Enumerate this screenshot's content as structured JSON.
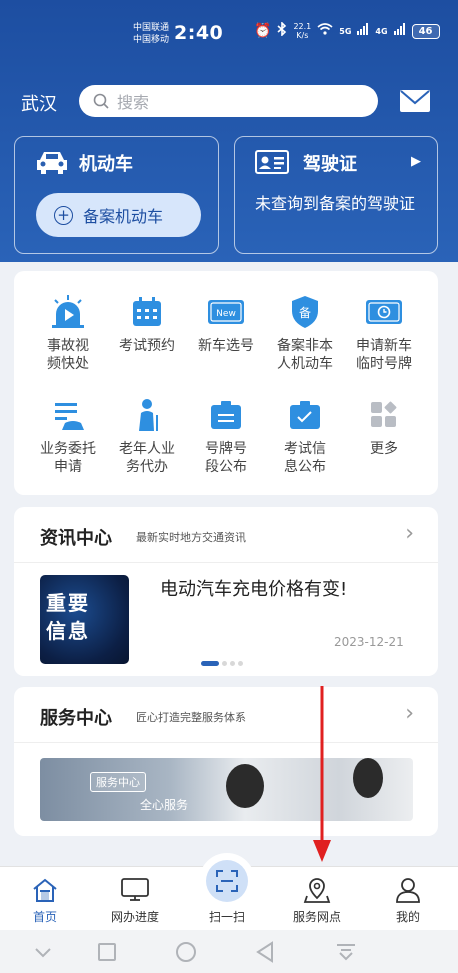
{
  "status_bar": {
    "carrier_1": "中国联通",
    "carrier_2": "中国移动",
    "time": "2:40",
    "net_speed_value": "22.1",
    "net_speed_unit": "K/s",
    "signal_1": "5G",
    "signal_2": "4G",
    "battery": "46"
  },
  "header": {
    "city": "武汉",
    "search_placeholder": "搜索"
  },
  "vehicle_card": {
    "title": "机动车",
    "button_label": "备案机动车"
  },
  "license_card": {
    "title": "驾驶证",
    "message": "未查询到备案的驾驶证"
  },
  "services": [
    {
      "label": "事故视频快处",
      "icon": "accident-video-icon"
    },
    {
      "label": "考试预约",
      "icon": "calendar-icon"
    },
    {
      "label": "新车选号",
      "icon": "new-plate-icon"
    },
    {
      "label": "备案非本人机动车",
      "icon": "shield-icon"
    },
    {
      "label": "申请新车临时号牌",
      "icon": "temp-plate-icon"
    },
    {
      "label": "业务委托申请",
      "icon": "delegate-icon"
    },
    {
      "label": "老年人业务代办",
      "icon": "elderly-icon"
    },
    {
      "label": "号牌号段公布",
      "icon": "plate-segment-icon"
    },
    {
      "label": "考试信息公布",
      "icon": "exam-info-icon"
    },
    {
      "label": "更多",
      "icon": "more-icon"
    }
  ],
  "news": {
    "title": "资讯中心",
    "subtitle": "最新实时地方交通资讯",
    "thumb_text": "重要信息",
    "item_title": "电动汽车充电价格有变!",
    "item_date": "2023-12-21"
  },
  "service_center": {
    "title": "服务中心",
    "subtitle": "匠心打造完整服务体系",
    "banner_tag": "服务中心",
    "banner_text": "全心服务"
  },
  "tabbar": [
    {
      "label": "首页",
      "icon": "home-icon",
      "active": true
    },
    {
      "label": "网办进度",
      "icon": "monitor-icon",
      "active": false
    },
    {
      "label": "扫一扫",
      "icon": "scan-icon",
      "active": false
    },
    {
      "label": "服务网点",
      "icon": "map-pin-icon",
      "active": false
    },
    {
      "label": "我的",
      "icon": "user-icon",
      "active": false
    }
  ],
  "colors": {
    "brand_blue": "#2a63b8",
    "annotation_red": "#e02020"
  }
}
